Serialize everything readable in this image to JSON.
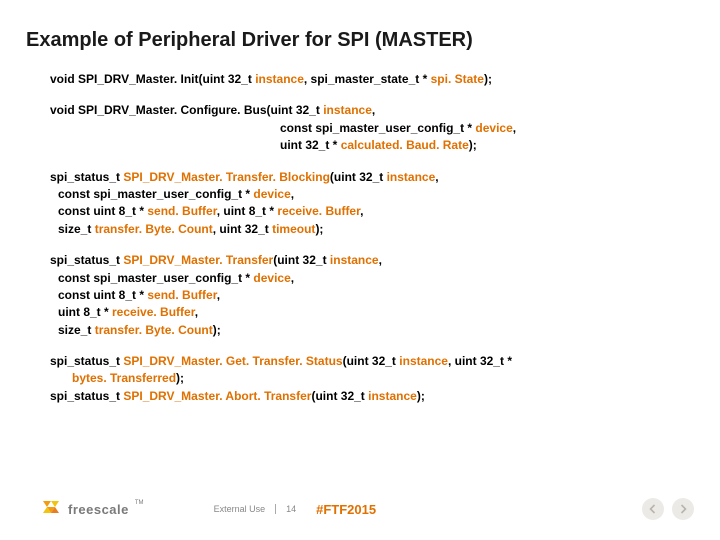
{
  "title": "Example of Peripheral Driver for SPI (MASTER)",
  "blocks": {
    "b1": {
      "p1a": "void SPI_DRV_Master. Init(uint 32_t",
      "p1b": "instance",
      "p1c": ", spi_master_state_t *",
      "p1d": "spi. State",
      "p1e": ");"
    },
    "b2": {
      "l1a": "void SPI_DRV_Master. Configure. Bus(uint 32_t",
      "l1b": "instance",
      "l1c": ",",
      "l2a": "const spi_master_user_config_t *",
      "l2b": "device",
      "l2c": ",",
      "l3a": "uint 32_t *",
      "l3b": "calculated. Baud. Rate",
      "l3c": ");"
    },
    "b3": {
      "l1a": "spi_status_t",
      "l1b": "SPI_DRV_Master. Transfer. Blocking",
      "l1c": "(uint 32_t",
      "l1d": "instance",
      "l1e": ",",
      "l2a": "const spi_master_user_config_t *",
      "l2b": "device",
      "l2c": ",",
      "l3a": "const uint 8_t *",
      "l3b": "send. Buffer",
      "l3c": ", uint 8_t *",
      "l3d": "receive. Buffer",
      "l3e": ",",
      "l4a": "size_t",
      "l4b": "transfer. Byte. Count",
      "l4c": ", uint 32_t",
      "l4d": "timeout",
      "l4e": ");"
    },
    "b4": {
      "l1a": "spi_status_t",
      "l1b": "SPI_DRV_Master. Transfer",
      "l1c": "(uint 32_t",
      "l1d": "instance",
      "l1e": ",",
      "l2a": "const spi_master_user_config_t *",
      "l2b": "device",
      "l2c": ",",
      "l3a": "const uint 8_t *",
      "l3b": "send. Buffer",
      "l3c": ",",
      "l4a": "uint 8_t *",
      "l4b": "receive. Buffer",
      "l4c": ",",
      "l5a": "size_t",
      "l5b": "transfer. Byte. Count",
      "l5c": ");"
    },
    "b5": {
      "l1a": "spi_status_t",
      "l1b": "SPI_DRV_Master. Get. Transfer. Status",
      "l1c": "(uint 32_t",
      "l1d": "instance",
      "l1e": ", uint 32_t *",
      "l2a": "bytes. Transferred",
      "l2b": ");",
      "l3a": "spi_status_t",
      "l3b": "SPI_DRV_Master. Abort. Transfer",
      "l3c": "(uint 32_t",
      "l3d": "instance",
      "l3e": ");"
    }
  },
  "footer": {
    "logo_text": "freescale",
    "tm": "TM",
    "external": "External Use",
    "page": "14",
    "hashtag": "#FTF2015"
  },
  "colors": {
    "orange": "#e07000",
    "logo_orange": "#f39c12",
    "logo_yellow": "#f1c40f",
    "nav_arrow": "#b8b4ab"
  }
}
